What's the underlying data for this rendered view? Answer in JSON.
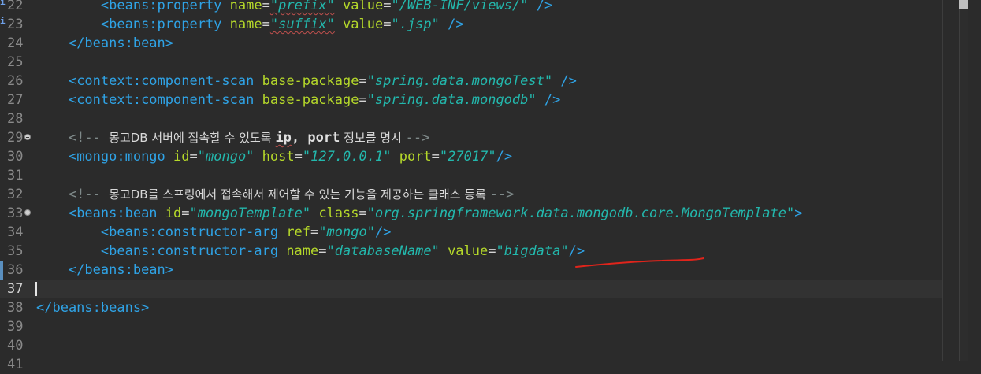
{
  "editor": {
    "lines": [
      {
        "n": "22",
        "segments": [
          {
            "t": "        "
          },
          {
            "c": "tag",
            "t": "<beans:property"
          },
          {
            "t": " "
          },
          {
            "c": "attr",
            "t": "name"
          },
          {
            "c": "eq",
            "t": "="
          },
          {
            "c": "val",
            "t": "\"prefix\"",
            "squig": true
          },
          {
            "t": " "
          },
          {
            "c": "attr",
            "t": "value"
          },
          {
            "c": "eq",
            "t": "="
          },
          {
            "c": "val",
            "t": "\"/WEB-INF/views/\""
          },
          {
            "t": " "
          },
          {
            "c": "tag",
            "t": "/>"
          }
        ],
        "info": true
      },
      {
        "n": "23",
        "segments": [
          {
            "t": "        "
          },
          {
            "c": "tag",
            "t": "<beans:property"
          },
          {
            "t": " "
          },
          {
            "c": "attr",
            "t": "name"
          },
          {
            "c": "eq",
            "t": "="
          },
          {
            "c": "val",
            "t": "\"suffix\"",
            "squig": true
          },
          {
            "t": " "
          },
          {
            "c": "attr",
            "t": "value"
          },
          {
            "c": "eq",
            "t": "="
          },
          {
            "c": "val",
            "t": "\".jsp\""
          },
          {
            "t": " "
          },
          {
            "c": "tag",
            "t": "/>"
          }
        ],
        "info": true
      },
      {
        "n": "24",
        "segments": [
          {
            "t": "    "
          },
          {
            "c": "tag",
            "t": "</beans:bean>"
          }
        ]
      },
      {
        "n": "25",
        "segments": []
      },
      {
        "n": "26",
        "segments": [
          {
            "t": "    "
          },
          {
            "c": "tag",
            "t": "<context:component-scan"
          },
          {
            "t": " "
          },
          {
            "c": "attr",
            "t": "base-package"
          },
          {
            "c": "eq",
            "t": "="
          },
          {
            "c": "val",
            "t": "\"spring.data.mongoTest\""
          },
          {
            "t": " "
          },
          {
            "c": "tag",
            "t": "/>"
          }
        ]
      },
      {
        "n": "27",
        "segments": [
          {
            "t": "    "
          },
          {
            "c": "tag",
            "t": "<context:component-scan"
          },
          {
            "t": " "
          },
          {
            "c": "attr",
            "t": "base-package"
          },
          {
            "c": "eq",
            "t": "="
          },
          {
            "c": "val",
            "t": "\"spring.data.mongodb\""
          },
          {
            "t": " "
          },
          {
            "c": "tag",
            "t": "/>"
          }
        ]
      },
      {
        "n": "28",
        "segments": []
      },
      {
        "n": "29",
        "fold": true,
        "segments": [
          {
            "t": "    "
          },
          {
            "c": "cm",
            "t": "<!-- "
          },
          {
            "c": "cmtext",
            "t": "몽고DB 서버에 접속할 수 있도록 "
          },
          {
            "c": "cmbold",
            "t": "ip",
            "squig": true
          },
          {
            "c": "cmbold",
            "t": ", port"
          },
          {
            "c": "cmtext",
            "t": " 정보를 명시 "
          },
          {
            "c": "cm",
            "t": "-->"
          }
        ]
      },
      {
        "n": "30",
        "segments": [
          {
            "t": "    "
          },
          {
            "c": "tag",
            "t": "<mongo:mongo"
          },
          {
            "t": " "
          },
          {
            "c": "attr",
            "t": "id"
          },
          {
            "c": "eq",
            "t": "="
          },
          {
            "c": "val",
            "t": "\"mongo\""
          },
          {
            "t": " "
          },
          {
            "c": "attr",
            "t": "host"
          },
          {
            "c": "eq",
            "t": "="
          },
          {
            "c": "val",
            "t": "\"127.0.0.1\""
          },
          {
            "t": " "
          },
          {
            "c": "attr",
            "t": "port"
          },
          {
            "c": "eq",
            "t": "="
          },
          {
            "c": "val",
            "t": "\"27017\""
          },
          {
            "c": "tag",
            "t": "/>"
          }
        ]
      },
      {
        "n": "31",
        "segments": []
      },
      {
        "n": "32",
        "segments": [
          {
            "t": "    "
          },
          {
            "c": "cm",
            "t": "<!-- "
          },
          {
            "c": "cmtext",
            "t": "몽고DB를 스프링에서 접속해서 제어할 수 있는 기능을 제공하는 클래스 등록 "
          },
          {
            "c": "cm",
            "t": "-->"
          }
        ]
      },
      {
        "n": "33",
        "fold": true,
        "segments": [
          {
            "t": "    "
          },
          {
            "c": "tag",
            "t": "<beans:bean"
          },
          {
            "t": " "
          },
          {
            "c": "attr",
            "t": "id"
          },
          {
            "c": "eq",
            "t": "="
          },
          {
            "c": "val",
            "t": "\"mongoTemplate\""
          },
          {
            "t": " "
          },
          {
            "c": "attr",
            "t": "class"
          },
          {
            "c": "eq",
            "t": "="
          },
          {
            "c": "val",
            "t": "\"org.springframework.data.mongodb.core.MongoTemplate\""
          },
          {
            "c": "tag",
            "t": ">"
          }
        ]
      },
      {
        "n": "34",
        "segments": [
          {
            "t": "        "
          },
          {
            "c": "tag",
            "t": "<beans:constructor-arg"
          },
          {
            "t": " "
          },
          {
            "c": "attr",
            "t": "ref"
          },
          {
            "c": "eq",
            "t": "="
          },
          {
            "c": "val",
            "t": "\"mongo\""
          },
          {
            "c": "tag",
            "t": "/>"
          }
        ]
      },
      {
        "n": "35",
        "segments": [
          {
            "t": "        "
          },
          {
            "c": "tag",
            "t": "<beans:constructor-arg"
          },
          {
            "t": " "
          },
          {
            "c": "attr",
            "t": "name"
          },
          {
            "c": "eq",
            "t": "="
          },
          {
            "c": "val",
            "t": "\"databaseName\""
          },
          {
            "t": " "
          },
          {
            "c": "attr",
            "t": "value"
          },
          {
            "c": "eq",
            "t": "="
          },
          {
            "c": "val",
            "t": "\"bigdata\""
          },
          {
            "c": "tag",
            "t": "/>"
          }
        ]
      },
      {
        "n": "36",
        "changed": true,
        "segments": [
          {
            "t": "    "
          },
          {
            "c": "tag",
            "t": "</beans:bean>"
          }
        ]
      },
      {
        "n": "37",
        "current": true,
        "segments": []
      },
      {
        "n": "38",
        "segments": [
          {
            "c": "tag",
            "t": "</beans:beans>"
          }
        ]
      },
      {
        "n": "39",
        "segments": []
      },
      {
        "n": "40",
        "segments": []
      },
      {
        "n": "41",
        "segments": []
      }
    ]
  },
  "colors": {
    "background": "#2b2b2b",
    "tag": "#2fa3e6",
    "attribute": "#b5d82a",
    "value": "#23b8ad",
    "comment": "#7f8a8a",
    "annotation_stroke": "#e0241b"
  }
}
